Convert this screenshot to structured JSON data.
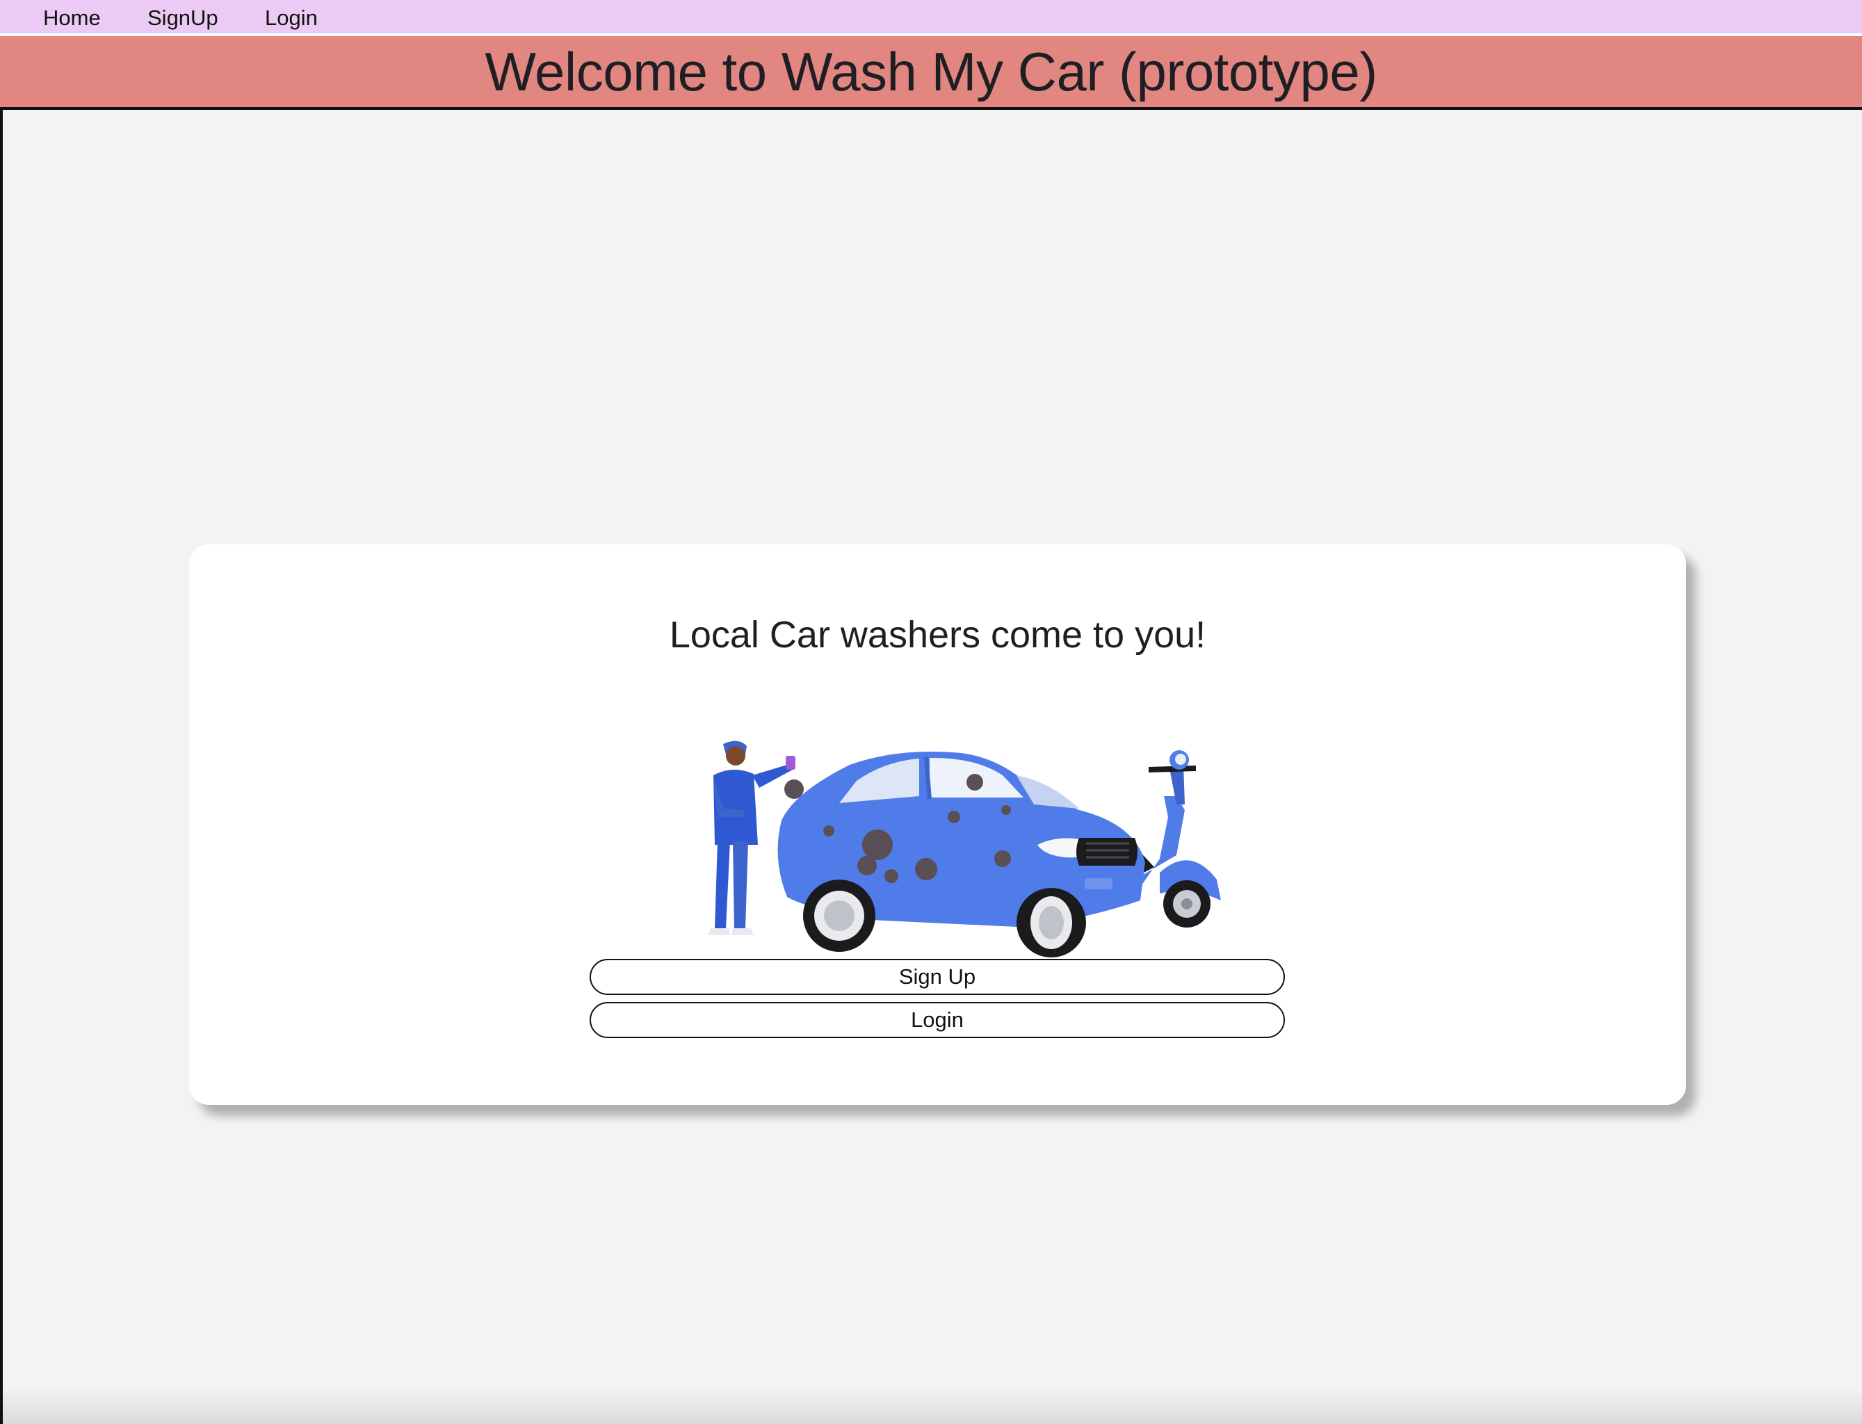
{
  "nav": {
    "items": [
      {
        "label": "Home"
      },
      {
        "label": "SignUp"
      },
      {
        "label": "Login"
      }
    ]
  },
  "banner": {
    "title": "Welcome to Wash My Car (prototype)"
  },
  "hero": {
    "heading": "Local Car washers come to you!",
    "illustration": "car-wash-illustration",
    "signup_label": "Sign Up",
    "login_label": "Login"
  },
  "colors": {
    "nav_bg": "#ebcbf4",
    "banner_bg": "#e18680",
    "page_bg": "#f2f4f3",
    "card_bg": "#ffffff",
    "car_blue": "#4f7ce8"
  }
}
